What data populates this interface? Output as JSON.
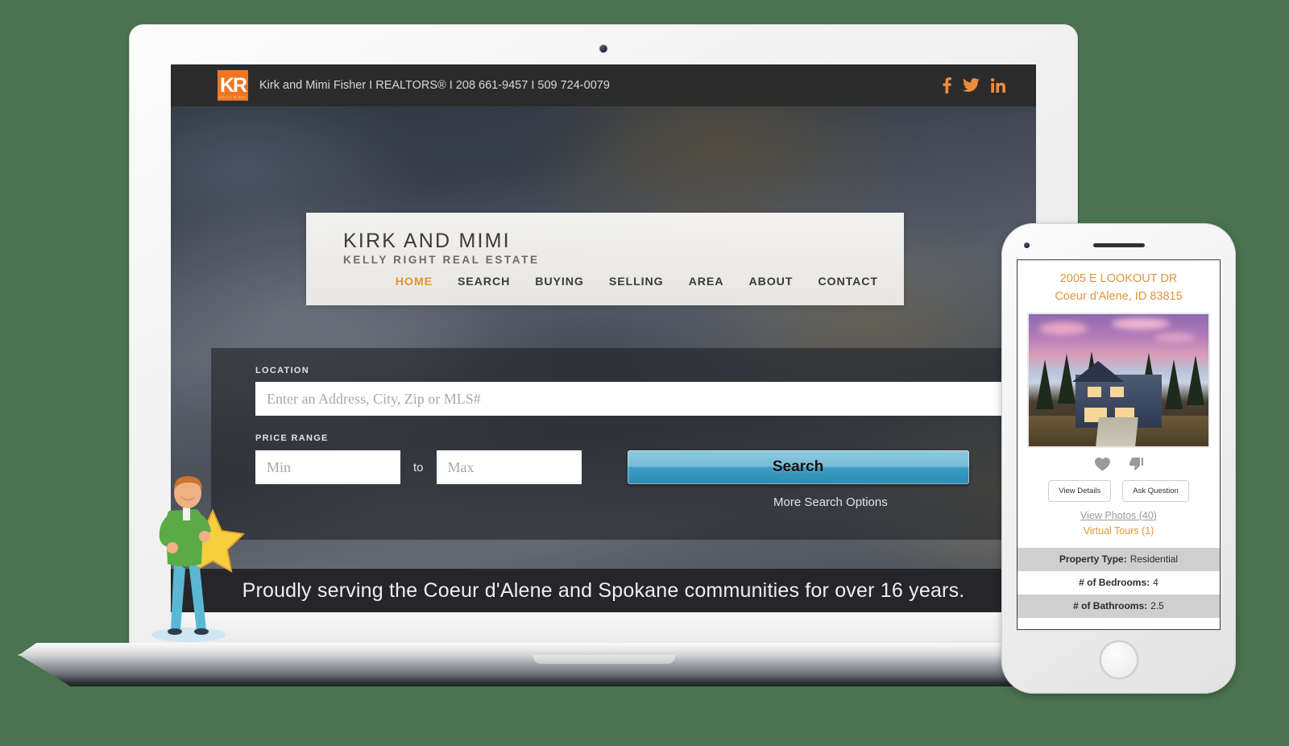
{
  "background_color": "#4a7350",
  "laptop": {
    "topbar": {
      "logo_letters": "KR",
      "logo_sub": "KELLY RIGHT",
      "logo_color": "#ee7623",
      "contact_line": "Kirk and Mimi Fisher I REALTORS® I 208 661-9457 I 509 724-0079",
      "socials": [
        {
          "name": "facebook-icon",
          "label": "Facebook"
        },
        {
          "name": "twitter-icon",
          "label": "Twitter"
        },
        {
          "name": "linkedin-icon",
          "label": "LinkedIn"
        }
      ],
      "social_color": "#ee8b3a"
    },
    "navcard": {
      "brand_title": "KIRK AND MIMI",
      "brand_subtitle": "KELLY RIGHT REAL ESTATE",
      "active_color": "#e8912f",
      "nav_items": [
        {
          "label": "HOME",
          "active": true
        },
        {
          "label": "SEARCH",
          "active": false
        },
        {
          "label": "BUYING",
          "active": false
        },
        {
          "label": "SELLING",
          "active": false
        },
        {
          "label": "AREA",
          "active": false
        },
        {
          "label": "ABOUT",
          "active": false
        },
        {
          "label": "CONTACT",
          "active": false
        }
      ]
    },
    "search_panel": {
      "location_label": "LOCATION",
      "location_placeholder": "Enter an Address, City, Zip or MLS#",
      "location_value": "",
      "price_label": "PRICE RANGE",
      "min_placeholder": "Min",
      "min_value": "",
      "max_placeholder": "Max",
      "max_value": "",
      "to_label": "to",
      "search_button": "Search",
      "search_button_color": "#3d9cc0",
      "more_options": "More Search Options"
    },
    "tagline": "Proudly serving the Coeur d'Alene and Spokane communities for over 16 years."
  },
  "phone": {
    "listing": {
      "address_line1": "2005 E LOOKOUT DR",
      "address_line2": "Coeur d'Alene, ID 83815",
      "address_color": "#e0953c",
      "photo_alt": "twilight-exterior-photo",
      "reactions": [
        {
          "name": "heart-icon",
          "label": "Favorite"
        },
        {
          "name": "thumbs-down-icon",
          "label": "Dislike"
        }
      ],
      "buttons": [
        {
          "label": "View Details"
        },
        {
          "label": "Ask Question"
        }
      ],
      "photos_link": "View Photos (40)",
      "tours_link": "Virtual Tours (1)",
      "details": [
        {
          "label": "Property Type:",
          "value": "Residential",
          "shaded": true
        },
        {
          "label": "# of Bedrooms:",
          "value": "4",
          "shaded": false
        },
        {
          "label": "# of Bathrooms:",
          "value": "2.5",
          "shaded": true
        }
      ]
    }
  },
  "mascot": {
    "description": "person-holding-star",
    "shirt_color": "#5aab46",
    "pants_color": "#5bb8d4",
    "star_color": "#f7cf3e"
  }
}
